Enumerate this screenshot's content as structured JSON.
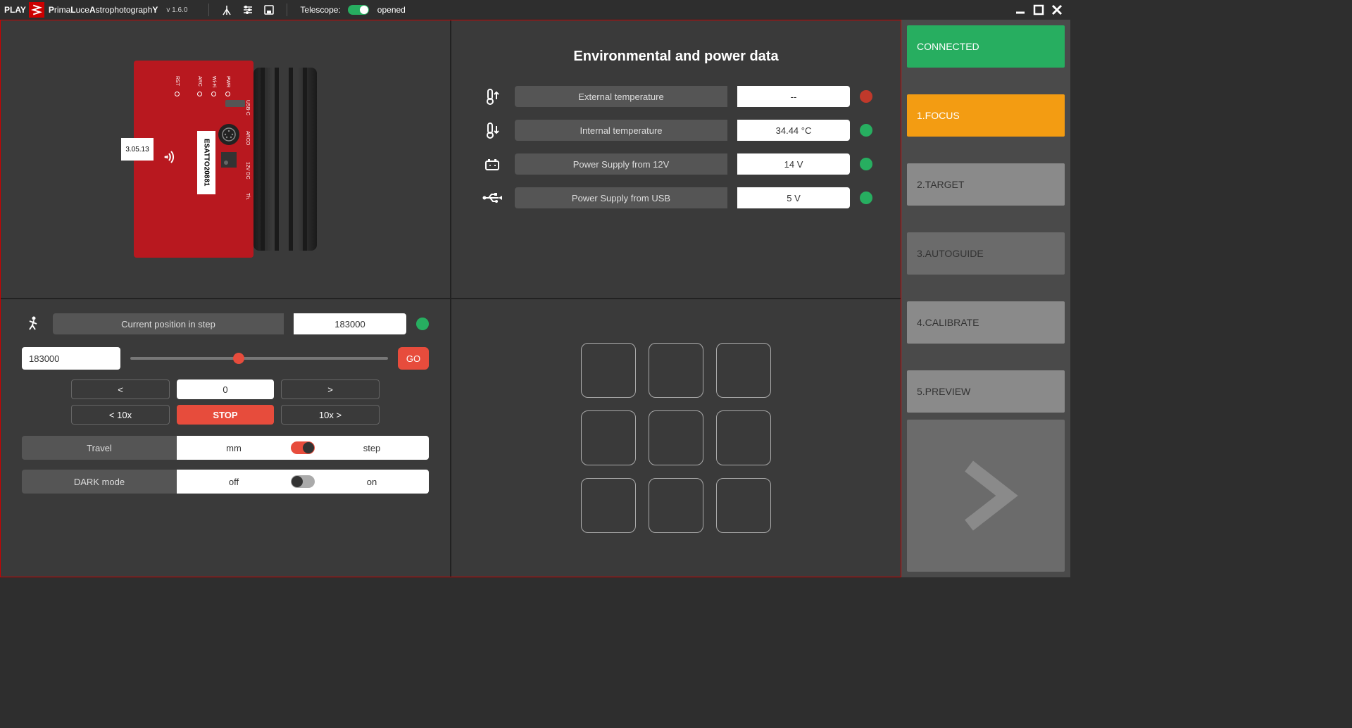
{
  "titlebar": {
    "play": "PLAY",
    "brand_html": "PrimaLuceAstrophotographY",
    "version": "v 1.6.0",
    "telescope_label": "Telescope:",
    "telescope_state": "opened"
  },
  "device": {
    "version": "3.05.13",
    "id": "ESATTO20881",
    "ports": {
      "pwr": "PWR",
      "wifi": "Wi-Fi",
      "arc": "ARC",
      "rst": "RST",
      "usbc": "USB-C",
      "arco": "ARCO",
      "12v": "12V DC",
      "th": "Th."
    }
  },
  "env": {
    "title": "Environmental and power data",
    "rows": [
      {
        "label": "External temperature",
        "value": "--",
        "led": "red",
        "icon": "temp-up"
      },
      {
        "label": "Internal temperature",
        "value": "34.44 °C",
        "led": "green",
        "icon": "temp-down"
      },
      {
        "label": "Power Supply from 12V",
        "value": "14 V",
        "led": "green",
        "icon": "battery"
      },
      {
        "label": "Power Supply from USB",
        "value": "5 V",
        "led": "green",
        "icon": "usb"
      }
    ]
  },
  "focuser": {
    "current_label": "Current position in step",
    "current_value": "183000",
    "current_led": "green",
    "input_value": "183000",
    "go_label": "GO",
    "btns": {
      "lt": "<",
      "step_val": "0",
      "gt": ">",
      "lt10": "< 10x",
      "stop": "STOP",
      "gt10": "10x >"
    },
    "travel": {
      "label": "Travel",
      "left": "mm",
      "right": "step",
      "state": "on"
    },
    "dark": {
      "label": "DARK mode",
      "left": "off",
      "right": "on",
      "state": "off"
    }
  },
  "sidebar": {
    "connected": "CONNECTED",
    "steps": [
      {
        "label": "1.FOCUS",
        "state": "active"
      },
      {
        "label": "2.TARGET",
        "state": "normal"
      },
      {
        "label": "3.AUTOGUIDE",
        "state": "dim"
      },
      {
        "label": "4.CALIBRATE",
        "state": "normal"
      },
      {
        "label": "5.PREVIEW",
        "state": "normal"
      }
    ]
  }
}
